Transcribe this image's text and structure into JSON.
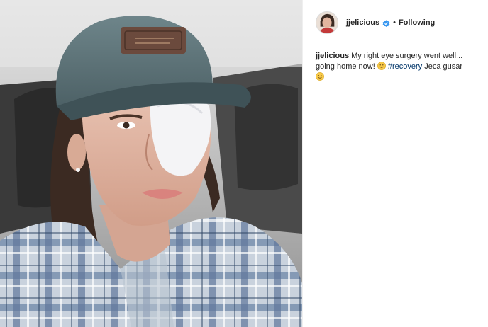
{
  "post": {
    "image_alt": "selfie photo",
    "author": {
      "username": "jjelicious",
      "verified_icon": "verified-badge-icon",
      "separator": "•",
      "follow_label": "Following"
    },
    "caption": {
      "username": "jjelicious",
      "text_before": "My right eye surgery went well... going home now!",
      "hashtag": "#recovery",
      "text_after": "Jeca gusar",
      "emoji_icons": [
        "smiling-face-icon",
        "smiling-face-icon"
      ]
    }
  },
  "colors": {
    "hashtag": "#003569",
    "verified": "#3897f0",
    "text": "#262626",
    "divider": "#efefef"
  }
}
